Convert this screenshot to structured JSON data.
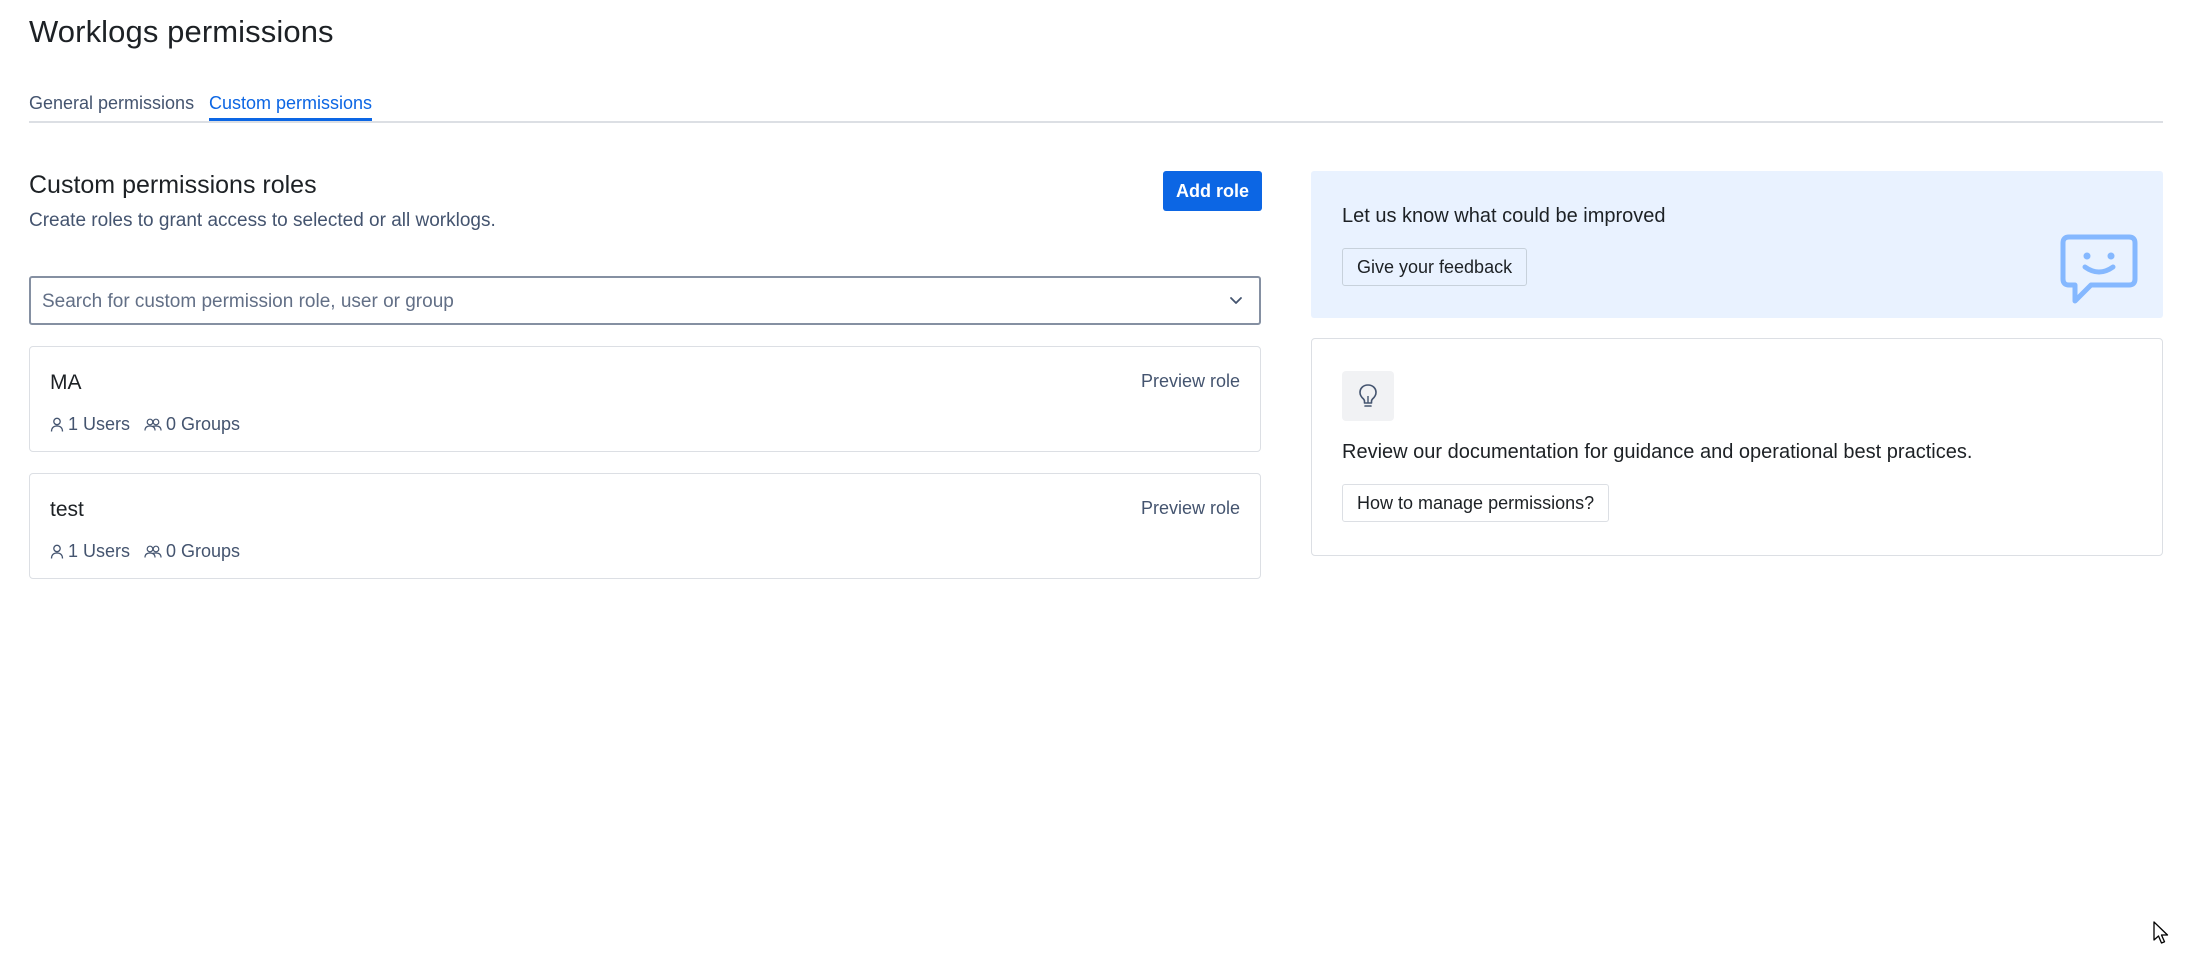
{
  "page": {
    "title": "Worklogs permissions"
  },
  "tabs": [
    {
      "label": "General permissions",
      "active": false
    },
    {
      "label": "Custom permissions",
      "active": true
    }
  ],
  "section": {
    "title": "Custom permissions roles",
    "subtitle": "Create roles to grant access to selected or all worklogs.",
    "add_role_label": "Add role"
  },
  "search": {
    "placeholder": "Search for custom permission role, user or group",
    "value": ""
  },
  "roles": [
    {
      "name": "MA",
      "users": "1 Users",
      "groups": "0 Groups",
      "preview_label": "Preview role"
    },
    {
      "name": "test",
      "users": "1 Users",
      "groups": "0 Groups",
      "preview_label": "Preview role"
    }
  ],
  "feedback": {
    "title": "Let us know what could be improved",
    "button_label": "Give your feedback",
    "icon": "chat-smiley-icon"
  },
  "docs": {
    "icon": "lightbulb-icon",
    "text": "Review our documentation for guidance and operational best practices.",
    "button_label": "How to manage permissions?"
  },
  "colors": {
    "primary": "#0c66e4",
    "feedback_bg": "#e9f2ff",
    "text": "#1d2125",
    "subtle_text": "#44546f",
    "border": "#dcdfe4"
  }
}
